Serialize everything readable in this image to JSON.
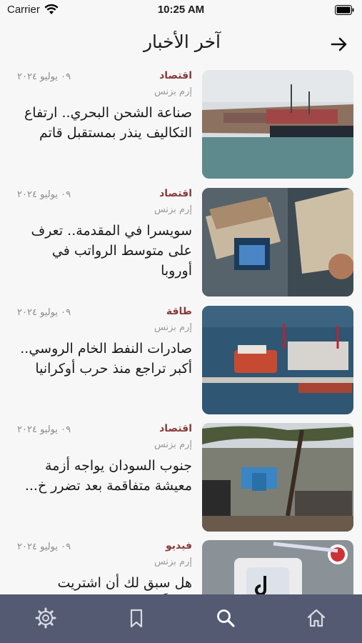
{
  "status_bar": {
    "carrier": "Carrier",
    "time": "10:25 AM"
  },
  "header": {
    "title": "آخر الأخبار",
    "back_icon": "arrow-right-icon"
  },
  "articles": [
    {
      "category": "اقتصاد",
      "source": "إرم بزنس",
      "date": "٠٩ يوليو ٢٠٢٤",
      "title": "صناعة الشحن البحري.. ارتفاع التكاليف ينذر بمستقبل قاتم"
    },
    {
      "category": "اقتصاد",
      "source": "إرم بزنس",
      "date": "٠٩ يوليو ٢٠٢٤",
      "title": "سويسرا في المقدمة.. تعرف على متوسط الرواتب في أوروبا"
    },
    {
      "category": "طاقة",
      "source": "إرم بزنس",
      "date": "٠٩ يوليو ٢٠٢٤",
      "title": "صادرات النفط الخام الروسي.. أكبر تراجع منذ حرب أوكرانيا"
    },
    {
      "category": "اقتصاد",
      "source": "إرم بزنس",
      "date": "٠٩ يوليو ٢٠٢٤",
      "title": "جنوب السودان يواجه أزمة معيشة متفاقمة بعد تضرر خ..."
    },
    {
      "category": "فيديو",
      "source": "إرم بزنس",
      "date": "٠٩ يوليو ٢٠٢٤",
      "title": "هل سبق لك أن اشتريت منتجاً.."
    }
  ],
  "colors": {
    "category": "#8a3a36",
    "tab_bar": "#545a72"
  },
  "tab_bar": {
    "icons": [
      "gear-icon",
      "bookmark-icon",
      "search-icon",
      "home-icon"
    ],
    "active": "search-icon"
  }
}
